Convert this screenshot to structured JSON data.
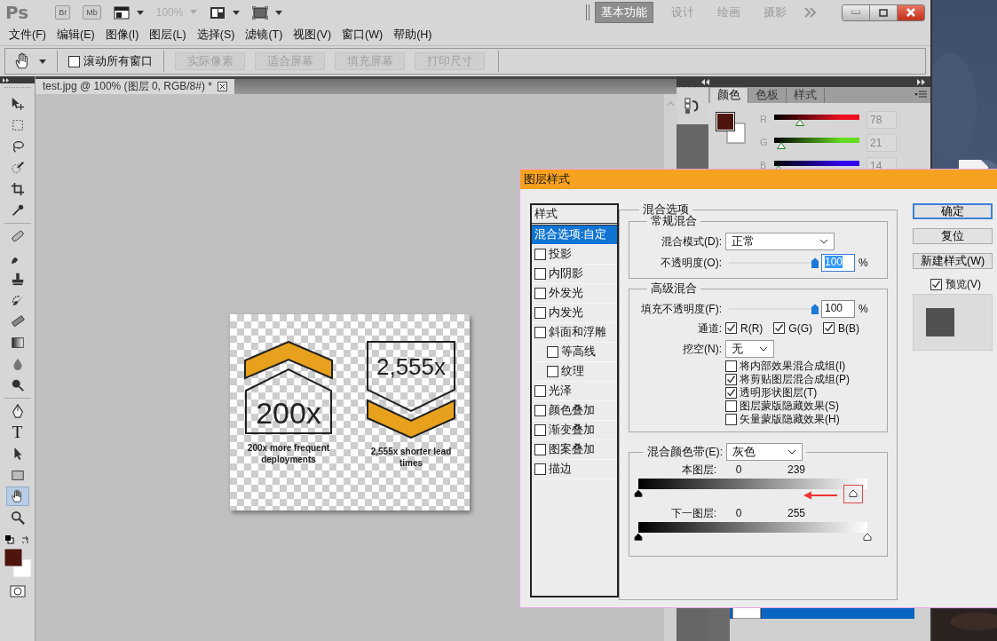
{
  "app_bar": {
    "logo": "Ps",
    "bridge": "Br",
    "mini_bridge": "Mb",
    "zoom": "100%",
    "workspaces": [
      {
        "label": "基本功能",
        "selected": true
      },
      {
        "label": "设计",
        "selected": false
      },
      {
        "label": "绘画",
        "selected": false
      },
      {
        "label": "摄影",
        "selected": false
      }
    ]
  },
  "menu": [
    "文件(F)",
    "编辑(E)",
    "图像(I)",
    "图层(L)",
    "选择(S)",
    "滤镜(T)",
    "视图(V)",
    "窗口(W)",
    "帮助(H)"
  ],
  "options_bar": {
    "scroll_all": {
      "label": "滚动所有窗口",
      "checked": false
    },
    "buttons": [
      "实际像素",
      "适合屏幕",
      "填充屏幕",
      "打印尺寸"
    ]
  },
  "tools": [
    {
      "kind": "move",
      "selected": false
    },
    {
      "kind": "marquee",
      "selected": false
    },
    {
      "kind": "lasso",
      "selected": false
    },
    {
      "kind": "quick",
      "selected": false
    },
    {
      "kind": "crop",
      "selected": false
    },
    {
      "kind": "eyedropper",
      "selected": false
    },
    {
      "kind": "healing",
      "selected": false
    },
    {
      "kind": "brush",
      "selected": false
    },
    {
      "kind": "stamp",
      "selected": false
    },
    {
      "kind": "history",
      "selected": false
    },
    {
      "kind": "eraser",
      "selected": false
    },
    {
      "kind": "gradient",
      "selected": false
    },
    {
      "kind": "blur",
      "selected": false
    },
    {
      "kind": "dodge",
      "selected": false
    },
    {
      "kind": "pen",
      "selected": false
    },
    {
      "kind": "type",
      "label": "T",
      "selected": false
    },
    {
      "kind": "pathselect",
      "selected": false
    },
    {
      "kind": "shape",
      "selected": false
    },
    {
      "kind": "hand",
      "selected": true
    },
    {
      "kind": "zoom",
      "selected": false
    }
  ],
  "document": {
    "tab": "test.jpg @ 100% (图层 0, RGB/8#) *",
    "badges": [
      {
        "kind": "up",
        "number": "200x",
        "caption": "200x more frequent deployments"
      },
      {
        "kind": "down",
        "number": "2,555x",
        "caption": "2,555x shorter lead times"
      }
    ]
  },
  "color_panel": {
    "tabs": [
      {
        "label": "颜色",
        "selected": true
      },
      {
        "label": "色板",
        "selected": false
      },
      {
        "label": "样式",
        "selected": false
      }
    ],
    "channels": [
      {
        "label": "R",
        "value": "78",
        "level": 0.306,
        "color": "#ee1020"
      },
      {
        "label": "G",
        "value": "21",
        "level": 0.082,
        "color": "#66dd22"
      },
      {
        "label": "B",
        "value": "14",
        "level": 0.055,
        "color": "#3300ee"
      }
    ]
  },
  "layers_panel": {
    "rows": [
      {
        "selected": true
      }
    ]
  },
  "dialog": {
    "title": "图层样式",
    "styles_header": "样式",
    "styles": [
      {
        "label": "混合选项:自定",
        "kind": "plain",
        "selected": true
      },
      {
        "label": "投影",
        "kind": "check",
        "checked": false,
        "selected": false
      },
      {
        "label": "内阴影",
        "kind": "check",
        "checked": false,
        "selected": false
      },
      {
        "label": "外发光",
        "kind": "check",
        "checked": false,
        "selected": false
      },
      {
        "label": "内发光",
        "kind": "check",
        "checked": false,
        "selected": false
      },
      {
        "label": "斜面和浮雕",
        "kind": "check",
        "checked": false,
        "selected": false,
        "children": [
          {
            "label": "等高线",
            "kind": "check",
            "checked": false,
            "selected": false
          },
          {
            "label": "纹理",
            "kind": "check",
            "checked": false,
            "selected": false
          }
        ]
      },
      {
        "label": "光泽",
        "kind": "check",
        "checked": false,
        "selected": false
      },
      {
        "label": "颜色叠加",
        "kind": "check",
        "checked": false,
        "selected": false
      },
      {
        "label": "渐变叠加",
        "kind": "check",
        "checked": false,
        "selected": false
      },
      {
        "label": "图案叠加",
        "kind": "check",
        "checked": false,
        "selected": false
      },
      {
        "label": "描边",
        "kind": "check",
        "checked": false,
        "selected": false
      }
    ],
    "blending": {
      "title": "混合选项",
      "general": {
        "title": "常规混合",
        "mode_label": "混合模式(D):",
        "mode": "正常",
        "opacity_label": "不透明度(O):",
        "opacity_slider": {
          "level": 1
        },
        "opacity": "100",
        "opacity_text_selected": true,
        "unit": "%"
      },
      "advanced": {
        "title": "高级混合",
        "fill_label": "填充不透明度(F):",
        "fill_slider": {
          "level": 1
        },
        "fill": "100",
        "unit": "%",
        "channels_label": "通道:",
        "channels": [
          {
            "label": "R(R)",
            "checked": true
          },
          {
            "label": "G(G)",
            "checked": true
          },
          {
            "label": "B(B)",
            "checked": true
          }
        ],
        "knockout_label": "挖空(N):",
        "knockout": "无",
        "options": [
          {
            "label": "将内部效果混合成组(I)",
            "checked": false
          },
          {
            "label": "将剪贴图层混合成组(P)",
            "checked": true
          },
          {
            "label": "透明形状图层(T)",
            "checked": true
          },
          {
            "label": "图层蒙版隐藏效果(S)",
            "checked": false
          },
          {
            "label": "矢量蒙版隐藏效果(H)",
            "checked": false
          }
        ]
      },
      "blend_if": {
        "label": "混合颜色带(E):",
        "value": "灰色",
        "rows": [
          {
            "label": "本图层:",
            "low": "0",
            "high": "239",
            "thumbs": [
              {
                "level": 0
              },
              {
                "level": 0.937,
                "highlighted": true
              }
            ]
          },
          {
            "label": "下一图层:",
            "low": "0",
            "high": "255",
            "thumbs": [
              {
                "level": 0
              },
              {
                "level": 1
              }
            ]
          }
        ]
      }
    },
    "buttons": [
      {
        "label": "确定",
        "default": true
      },
      {
        "label": "复位",
        "default": false
      },
      {
        "label": "新建样式(W)",
        "default": false
      }
    ],
    "preview": {
      "label": "预览(V)",
      "checked": true
    }
  }
}
